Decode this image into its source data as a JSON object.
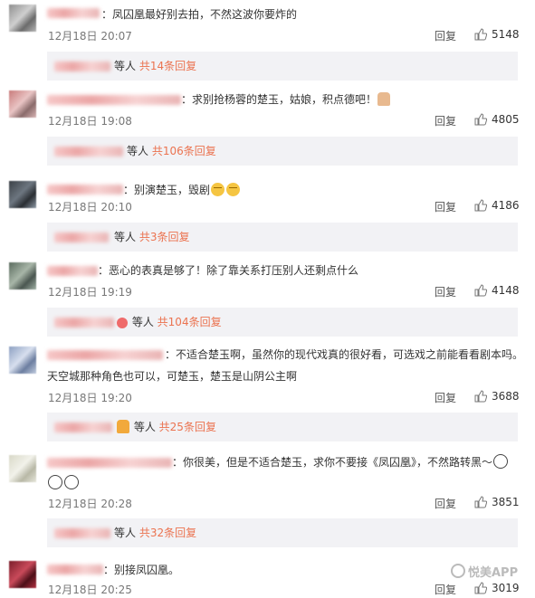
{
  "comments": [
    {
      "text": "：凤囚凰最好别去拍，不然这波你要炸的",
      "time": "12月18日 20:07",
      "reply": "回复",
      "likes": "5148",
      "sub": {
        "suffix": "等人",
        "count": "共14条回复"
      }
    },
    {
      "text": "：求别抢杨蓉的楚玉，姑娘，积点德吧！",
      "time": "12月18日 19:08",
      "reply": "回复",
      "likes": "4805",
      "sub": {
        "suffix": "等人",
        "count": "共106条回复"
      }
    },
    {
      "text": "：别演楚玉，毁剧",
      "time": "12月18日 20:10",
      "reply": "回复",
      "likes": "4186",
      "sub": {
        "suffix": "等人",
        "count": "共3条回复"
      }
    },
    {
      "text": "：恶心的表真是够了！除了靠关系打压别人还剩点什么",
      "time": "12月18日 19:19",
      "reply": "回复",
      "likes": "4148",
      "sub": {
        "suffix": "等人",
        "count": "共104条回复"
      }
    },
    {
      "text": "：不适合楚玉啊，虽然你的现代戏真的很好看，可选戏之前能看看剧本吗。",
      "text2": "天空城那种角色也可以，可楚玉，楚玉是山阴公主啊",
      "time": "12月18日 19:20",
      "reply": "回复",
      "likes": "3688",
      "sub": {
        "suffix": "等人",
        "count": "共25条回复"
      }
    },
    {
      "text": "：你很美，但是不适合楚玉，求你不要接《凤囚凰》，不然路转黑～",
      "time": "12月18日 20:28",
      "reply": "回复",
      "likes": "3851",
      "sub": {
        "suffix": "等人",
        "count": "共32条回复"
      }
    },
    {
      "text": "：别接凤囚凰。",
      "time": "12月18日 20:25",
      "reply": "回复",
      "likes": "3019"
    }
  ],
  "watermark": "悦美APP",
  "colors": {
    "link": "#eb7350",
    "subbox": "#f2f2f5",
    "text": "#333333",
    "meta": "#777777"
  }
}
